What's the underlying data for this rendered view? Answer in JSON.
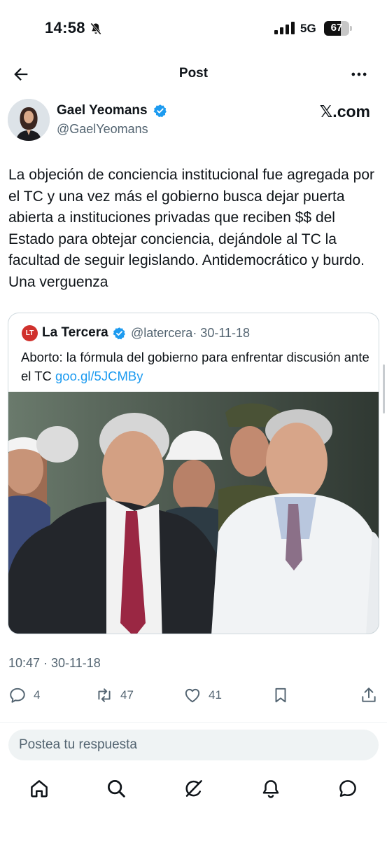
{
  "status_bar": {
    "time": "14:58",
    "network": "5G",
    "battery": "67",
    "battery_level": 0.67
  },
  "header": {
    "title": "Post"
  },
  "author": {
    "name": "Gael Yeomans",
    "handle": "@GaelYeomans",
    "source": "𝕏.com"
  },
  "tweet": {
    "text": "La objeción de conciencia institucional fue agregada por el TC y una vez más el gobierno busca dejar puerta abierta a instituciones privadas que reciben $$ del Estado para obtejar conciencia, dejándole al TC la facultad de seguir legislando. Antidemocrático y burdo. Una verguenza",
    "timestamp": "10:47 · 30-11-18"
  },
  "quote": {
    "logo_text": "LT",
    "name": "La Tercera",
    "handle": "@latercera",
    "date": "· 30-11-18",
    "text": "Aborto: la fórmula del gobierno para enfrentar discusión ante el TC",
    "link": "goo.gl/5JCMBy"
  },
  "actions": {
    "replies": "4",
    "reposts": "47",
    "likes": "41"
  },
  "reply": {
    "placeholder": "Postea tu respuesta"
  },
  "nav": {
    "items": [
      "home-icon",
      "search-icon",
      "grok-icon",
      "notifications-icon",
      "messages-icon"
    ]
  },
  "colors": {
    "accent": "#1d9bf0",
    "secondary_text": "#536471",
    "logo_red": "#d0312d"
  }
}
